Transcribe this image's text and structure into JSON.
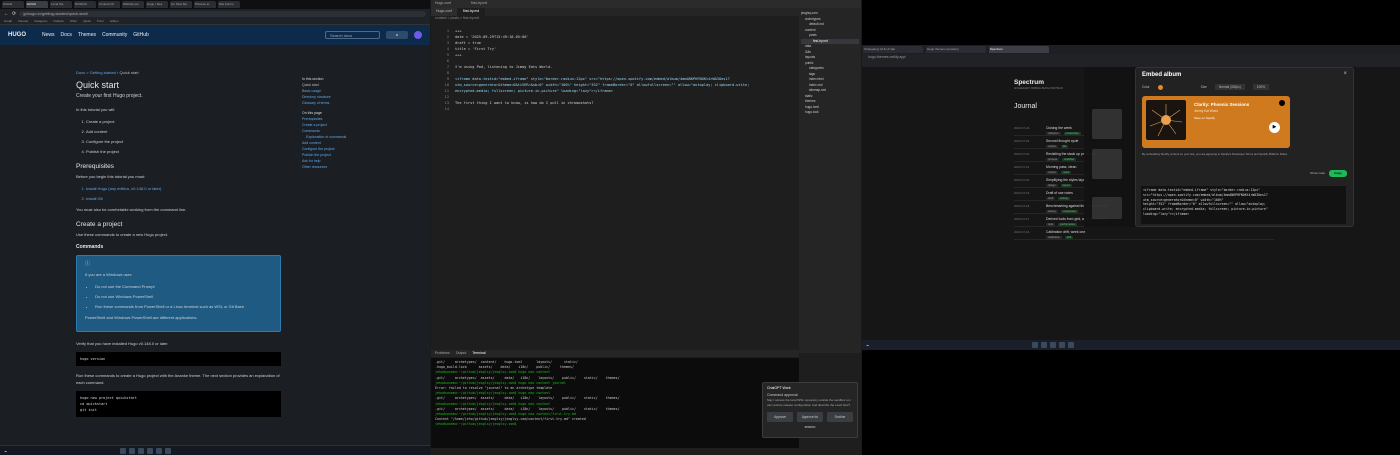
{
  "browser1": {
    "tabs": [
      "GitHub",
      "HUGO",
      "Local Ste",
      "NOSIGN",
      "Content Ch",
      "Website pro",
      "Hugo • Res",
      "Go Next Mo",
      "Photoso to",
      "Site Forms"
    ],
    "url": "gohugo.io/getting-started/quick-start/",
    "bookmarks": [
      "Gmail",
      "Canvas",
      "Instagram",
      "Outlook",
      "Other",
      "Quick",
      "Tutor",
      "Gitbox"
    ]
  },
  "hugo": {
    "logo": "HUGO",
    "nav": [
      "News",
      "Docs",
      "Themes",
      "Community",
      "GitHub"
    ],
    "search_placeholder": "Search docs",
    "breadcrumb": "Docs > Getting started",
    "breadcrumb_current": "Quick start",
    "title": "Quick start",
    "lead": "Create your first Hugo project.",
    "intro": "In this tutorial you will:",
    "steps": [
      "Create a project",
      "Add content",
      "Configure the project",
      "Publish the project"
    ],
    "h_prereq": "Prerequisites",
    "prereq_intro": "Before you begin this tutorial you must:",
    "prereqs": [
      "Install Hugo (any edition, v0.148.0 or later)",
      "Install Git"
    ],
    "cli_note": "You must also be comfortable working from the command line.",
    "h_create": "Create a project",
    "create_intro": "Use these commands to create a new Hugo project.",
    "h_commands": "Commands",
    "callout_title": "If you are a Windows user:",
    "callout_items": [
      "Do not use the Command Prompt",
      "Do not use Windows PowerShell",
      "Run these commands from PowerShell or a Linux terminal such as WSL or Git Bash"
    ],
    "callout_foot": "PowerShell and Windows PowerShell are different applications.",
    "verify": "Verify that you have installed Hugo v0.148.0 or later.",
    "code1": "hugo version",
    "run_note": "Run these commands to create a Hugo project with the Ananke theme. The next section provides an explanation of each command.",
    "code2": "hugo new project quickstart\ncd quickstart\ngit init",
    "toc": {
      "h1": "In this section",
      "items1": [
        "Quick start",
        "Basic usage",
        "Directory structure",
        "Glossary of terms"
      ],
      "h2": "On this page",
      "items2": [
        "Prerequisites",
        "Create a project",
        "Commands",
        "Explanation of commands",
        "Add content",
        "Configure the project",
        "Publish the project",
        "Ask for help",
        "Other resources"
      ]
    }
  },
  "editor": {
    "title_items": [
      "Hugo.conf",
      "first-try.md"
    ],
    "tabs": [
      "Hugo.conf",
      "first-try.md"
    ],
    "breadcrumb": "content > posts > first-try.md",
    "line_numbers": [
      "1",
      "2",
      "3",
      "4",
      "5",
      "6",
      "7",
      "8",
      "9",
      "10",
      "11",
      "12",
      "13",
      "14"
    ],
    "code_lines": [
      "+++",
      "date = '2025-09-29T15:49:18-05:00'",
      "draft = true",
      "title = 'First Try'",
      "+++",
      "",
      "I'm using Pod, listening to Jimmy Eats World.",
      "",
      "<iframe data-testid=\"embed-iframe\" style=\"border-radius:12px\" src=\"https://open.spotify.com/embed/album/4mm4NKPHFNOKt4rWA3Oes1?",
      "utm_source=generator&theme=0&tiVER=&sb=0\" width=\"100%\" height=\"352\" frameBorder=\"0\" allowfullscreen=\"\" allow=\"autoplay; clipboard-write;",
      "encrypted-media; fullscreen; picture-in-picture\" loading=\"lazy\"></iframe>",
      "",
      "The first thing I want to know, is how do I pull in chromoshots?",
      ""
    ],
    "explorer": [
      "jeoglsy.com",
      "archetypes",
      "default.md",
      "content",
      "posts",
      "first-try.md",
      "data",
      "i18n",
      "layouts",
      "public",
      "categories",
      "tags",
      "index.html",
      "index.xml",
      "sitemap.xml",
      "static",
      "themes",
      "hugo.toml",
      "hugo.lock"
    ],
    "terminal_tabs": [
      "Problems",
      "Output",
      "Terminal"
    ],
    "terminal": [
      ".git/     archetypes/  content/    hugo.toml       layouts/      static/",
      ".hugo_build.lock      assets/    data/    i18n/    public/     themes/",
      "jehodsonemu:~/github/jeoglsy/jeoglsy.com$ hugo new content",
      ".git/     archetypes/  assets/     data/   i18n/    layouts/    public/    static/    themes/",
      "jehodsonemu:~/github/jeoglsy/jeoglsy.com$ hugo new content journal",
      "Error: failed to resolve \"journal\" to an archetype template",
      "jehodsonemu:~/github/jeoglsy/jeoglsy.com$ hugo new content",
      ".git/     archetypes/  assets/     data/   i18n/    layouts/    public/    static/    themes/",
      "jehodsonemu:~/github/jeoglsy/jeoglsy.com$ hugo new content",
      ".git/     archetypes/  assets/     data/   i18n/    layouts/    public/    static/    themes/",
      "jehodsonemu:~/github/jeoglsy/jeoglsy.com$ hugo new content/first-try.md",
      "Content \"/home/jeho/github/jeoglsy/jeoglsy.com/content/first-try.md\" created",
      "jehodsonemu:~/github/jeoglsy/jeoglsy.com$"
    ],
    "notification": {
      "title": "ChatGPT Work",
      "heading": "Command approval",
      "body": "May I access the local WSL repository outside the sandbox so I can read its release configuration and describe the exact flow?",
      "btn1": "Approve",
      "btn2": "Approve for session",
      "btn3": "Decline"
    }
  },
  "browser3": {
    "url": "hugo-themes.netlify.app/",
    "tabs": [
      "Changelog: AI & UI Jan",
      "Hugo themes repository",
      "Spectrum"
    ]
  },
  "spectrum": {
    "name": "Spectrum",
    "subtitle": "AN ELEGANT, MINIMAL BLOG FOR HUGO",
    "journal": "Journal",
    "entries": [
      {
        "date": "2023-07-24",
        "title": "Closing the week",
        "tags": [
          "reflection",
          "productivity"
        ]
      },
      {
        "date": "2023-07-23",
        "title": "Second thought cycle",
        "tags": [
          "routine",
          "life"
        ]
      },
      {
        "date": "2023-07-22",
        "title": "Revisiting the stack up processes",
        "tags": [
          "process",
          "workflow"
        ]
      },
      {
        "date": "2023-07-21",
        "title": "Morning pass, clean",
        "tags": [
          "routine",
          "notes"
        ]
      },
      {
        "date": "2023-07-20",
        "title": "Simplifying the styles layout",
        "tags": [
          "design",
          "layout"
        ]
      },
      {
        "date": "2023-07-19",
        "title": "Draft of use notes",
        "tags": [
          "draft",
          "writing"
        ]
      },
      {
        "date": "2023-07-18",
        "title": "Benchmarking against the reference card",
        "tags": [
          "testing",
          "comparison"
        ]
      },
      {
        "date": "2023-07-17",
        "title": "Derived tools from grid, and refresh cost",
        "tags": [
          "tools",
          "performance"
        ]
      },
      {
        "date": "2023-07-16",
        "title": "Calibration drift, week one",
        "tags": [
          "calibration",
          "drift"
        ]
      }
    ],
    "embed_modal": {
      "title": "Embed album",
      "color_label": "Color",
      "size_label": "Size",
      "size_value": "Normal (352px)",
      "width_value": "100%",
      "album": "Clarity: Phoenix Sessions",
      "artist": "Jimmy Eat World",
      "save": "Save on Spotify",
      "tos": "By embedding Spotify content on your site, you are agreeing to Spotify's Developer Terms and Spotify Platform Rules.",
      "show_code": "Show code",
      "copy": "Copy",
      "code": "<iframe data-testid=\"embed-iframe\" style=\"border-radius:12px\"\nsrc=\"https://open.spotify.com/embed/album/4mm4NKPHFNOKt4rWA3Oes1?\nutm_source=generator&theme=0\" width=\"100%\"\nheight=\"352\" frameBorder=\"0\" allowfullscreen=\"\" allow=\"autoplay;\nclipboard-write; encrypted-media; fullscreen; picture-in-picture\"\nloading=\"lazy\"></iframe>"
    }
  },
  "colors": {
    "hugo_nav": "#0d2a4a",
    "callout": "#1f5a82",
    "spotify_green": "#1db954",
    "embed_orange": "#d07a1f"
  }
}
